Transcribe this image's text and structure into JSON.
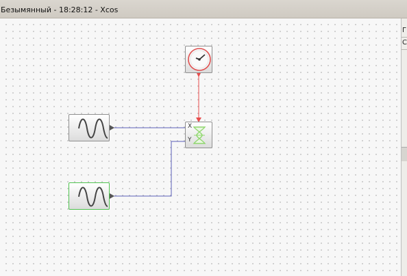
{
  "window": {
    "title": "Безымянный - 18:28:12 - Xcos"
  },
  "side_panel": {
    "row1": "Г",
    "row2": "С"
  },
  "diagram": {
    "blocks": [
      {
        "name": "clock-block",
        "icon": "clock-icon"
      },
      {
        "name": "sine-generator-block-1",
        "icon": "sine-wave-icon"
      },
      {
        "name": "sine-generator-block-2",
        "icon": "sine-wave-icon",
        "selected": true
      },
      {
        "name": "xy-scope-block",
        "icon": "scope-icon"
      }
    ],
    "scope_ports": {
      "x_label": "X",
      "y_label": "Y"
    },
    "colors": {
      "event_link": "#e84c4c",
      "data_link": "#5b5fb8",
      "selected_outline": "#4fc34f",
      "scope_icon": "#8fd66e"
    }
  }
}
